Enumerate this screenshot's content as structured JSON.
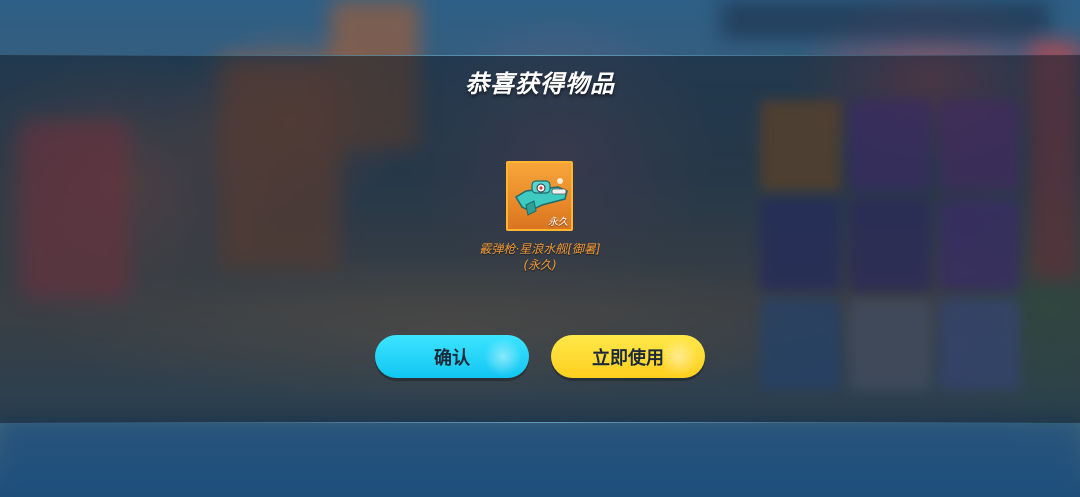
{
  "dialog": {
    "title": "恭喜获得物品"
  },
  "reward": {
    "icon": "water-gun-icon",
    "duration_badge": "永久",
    "name_line1": "霰弹枪·星浪水舰[御暑]",
    "name_line2": "(永久)",
    "rarity_color": "#f39a36"
  },
  "buttons": {
    "confirm_label": "确认",
    "use_label": "立即使用"
  },
  "colors": {
    "confirm_button": "#12c6f2",
    "use_button": "#ffcf1f",
    "item_frame": "#ffb52e"
  }
}
